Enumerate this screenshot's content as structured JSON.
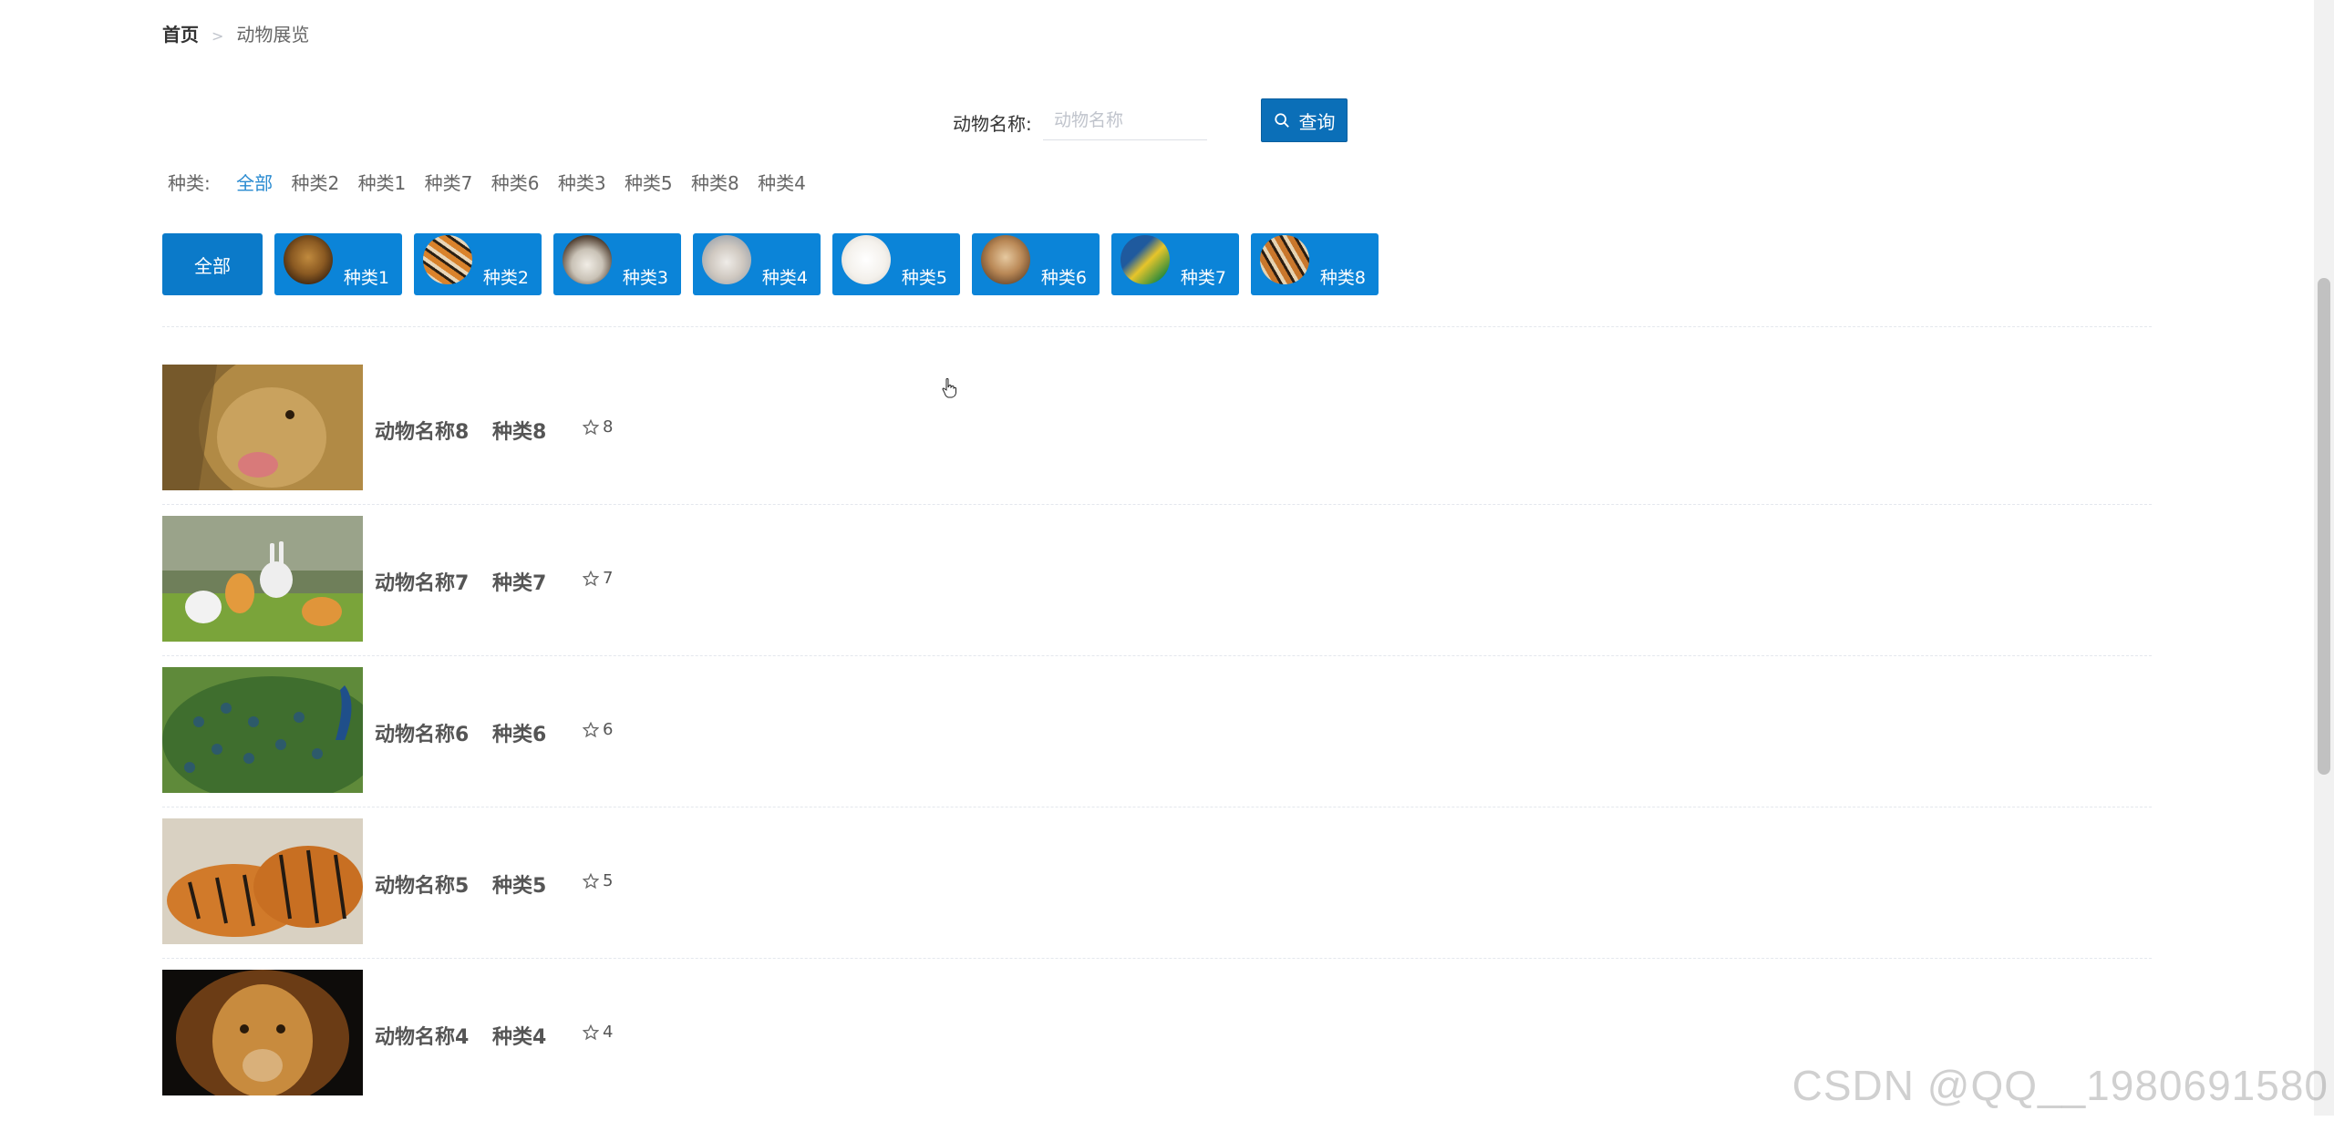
{
  "breadcrumb": {
    "home": "首页",
    "separator": ">",
    "current": "动物展览"
  },
  "search": {
    "label": "动物名称:",
    "placeholder": "动物名称",
    "value": "",
    "button_label": "查询",
    "button_icon": "search-icon"
  },
  "filter": {
    "label": "种类:",
    "items": [
      "全部",
      "种类2",
      "种类1",
      "种类7",
      "种类6",
      "种类3",
      "种类5",
      "种类8",
      "种类4"
    ],
    "active_index": 0
  },
  "tiles": {
    "all_label": "全部",
    "items": [
      {
        "label": "种类1",
        "icon": "lion-avatar"
      },
      {
        "label": "种类2",
        "icon": "tiger-avatar"
      },
      {
        "label": "种类3",
        "icon": "rabbit-avatar"
      },
      {
        "label": "种类4",
        "icon": "cat-avatar"
      },
      {
        "label": "种类5",
        "icon": "dog-avatar"
      },
      {
        "label": "种类6",
        "icon": "puppy-avatar"
      },
      {
        "label": "种类7",
        "icon": "parrot-avatar"
      },
      {
        "label": "种类8",
        "icon": "tiger-avatar"
      }
    ]
  },
  "animals": [
    {
      "name": "动物名称8",
      "category": "种类8",
      "likes": "8",
      "image": "lion-photo"
    },
    {
      "name": "动物名称7",
      "category": "种类7",
      "likes": "7",
      "image": "rabbits-photo"
    },
    {
      "name": "动物名称6",
      "category": "种类6",
      "likes": "6",
      "image": "peacock-photo"
    },
    {
      "name": "动物名称5",
      "category": "种类5",
      "likes": "5",
      "image": "tigers-photo"
    },
    {
      "name": "动物名称4",
      "category": "种类4",
      "likes": "4",
      "image": "lion-face-photo"
    }
  ],
  "watermark": "CSDN @QQ__1980691580",
  "colors": {
    "primary": "#0b84d8",
    "button": "#0b6fb8",
    "active_filter": "#2a8bd1"
  }
}
